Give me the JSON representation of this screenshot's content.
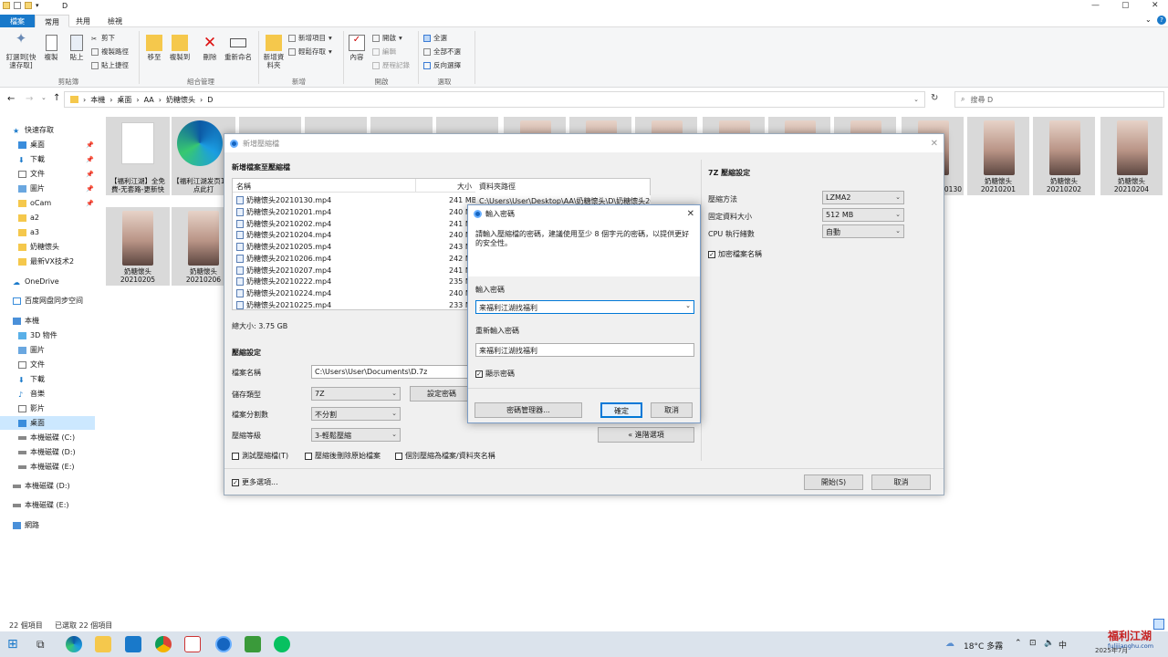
{
  "window": {
    "title": "D"
  },
  "tabs": [
    "檔案",
    "常用",
    "共用",
    "檢視"
  ],
  "ribbon": {
    "clipboard": {
      "pin_label": "釘選到[快速存取]",
      "copy_label": "複製",
      "paste_label": "貼上",
      "cut_label": "剪下",
      "copy_path_label": "複製路徑",
      "paste_shortcut_label": "貼上捷徑",
      "group": "剪貼簿"
    },
    "organize": {
      "move_label": "移至",
      "copy_to_label": "複製到",
      "delete_label": "刪除",
      "rename_label": "重新命名",
      "group": "組合管理"
    },
    "new": {
      "new_folder_label": "新增資料夾",
      "new_item_label": "新增項目",
      "easy_access_label": "輕鬆存取",
      "group": "新增"
    },
    "open": {
      "properties_label": "內容",
      "open_label": "開啟",
      "edit_label": "編輯",
      "history_label": "歷程記錄",
      "group": "開啟"
    },
    "select": {
      "select_all_label": "全選",
      "select_none_label": "全部不選",
      "invert_label": "反向選擇",
      "group": "選取"
    }
  },
  "address": {
    "parts": [
      "本機",
      "桌面",
      "AA",
      "奶糖懷头",
      "D"
    ],
    "search_placeholder": "搜尋 D"
  },
  "nav": {
    "quick_access": "快速存取",
    "quick_items": [
      "桌面",
      "下載",
      "文件",
      "圖片",
      "oCam",
      "a2",
      "a3",
      "奶糖懷头",
      "最新VX技术2"
    ],
    "onedrive": "OneDrive",
    "baidu": "百度网盘同步空间",
    "this_pc": "本機",
    "pc_items": [
      "3D 物件",
      "圖片",
      "文件",
      "下載",
      "音樂",
      "影片",
      "桌面",
      "本機磁碟 (C:)",
      "本機磁碟 (D:)",
      "本機磁碟 (E:)"
    ],
    "drives": [
      "本機磁碟 (D:)",
      "本機磁碟 (E:)"
    ],
    "network": "網路"
  },
  "tiles": {
    "t1": "【福利江湖】全免費-无套路-更新快",
    "t2": "【福利江湖发页1】-点此打",
    "r1": [
      "20210130",
      "奶糖懷头\n20210201",
      "奶糖懷头\n20210202",
      "奶糖懷头\n20210204"
    ],
    "r2": [
      "奶糖懷头\n20210205",
      "奶糖懷头\n20210206"
    ]
  },
  "status": {
    "count": "22 個項目",
    "selected": "已選取 22 個項目"
  },
  "taskbar": {
    "weather": "18°C 多霧",
    "time": "2025年7月"
  },
  "watermark": {
    "text": "福利江湖",
    "sub": "fulijianghu.com"
  },
  "archive": {
    "title": "新增壓縮檔",
    "heading": "新增檔案至壓縮檔",
    "col_name": "名稱",
    "col_size": "大小",
    "col_path": "資料夾路徑",
    "files": [
      {
        "name": "奶糖懷头20210130.mp4",
        "size": "241 MB",
        "path": "C:\\Users\\User\\Desktop\\AA\\奶糖懷头\\D\\奶糖懷头20210..."
      },
      {
        "name": "奶糖懷头20210201.mp4",
        "size": "240 MB",
        "path": ""
      },
      {
        "name": "奶糖懷头20210202.mp4",
        "size": "241 MB",
        "path": ""
      },
      {
        "name": "奶糖懷头20210204.mp4",
        "size": "240 MB",
        "path": ""
      },
      {
        "name": "奶糖懷头20210205.mp4",
        "size": "243 MB",
        "path": ""
      },
      {
        "name": "奶糖懷头20210206.mp4",
        "size": "242 MB",
        "path": ""
      },
      {
        "name": "奶糖懷头20210207.mp4",
        "size": "241 MB",
        "path": ""
      },
      {
        "name": "奶糖懷头20210222.mp4",
        "size": "235 MB",
        "path": ""
      },
      {
        "name": "奶糖懷头20210224.mp4",
        "size": "240 MB",
        "path": ""
      },
      {
        "name": "奶糖懷头20210225.mp4",
        "size": "233 MB",
        "path": ""
      }
    ],
    "total": "總大小: 3.75 GB",
    "settings_heading": "壓縮設定",
    "file_name_label": "檔案名稱",
    "file_name_value": "C:\\Users\\User\\Documents\\D.7z",
    "type_label": "儲存類型",
    "type_value": "7Z",
    "split_label": "檔案分割數",
    "split_value": "不分割",
    "level_label": "壓縮等級",
    "level_value": "3-輕鬆壓縮",
    "set_pwd_btn": "設定密碼",
    "advanced_btn": "« 進階選項",
    "test_cb": "測試壓縮檔(T)",
    "delete_cb": "壓縮後刪除原始檔案",
    "separate_cb": "個別壓縮為檔案/資料夾名稱",
    "more_cb": "更多選項...",
    "start_btn": "開始(S)",
    "cancel_btn": "取消",
    "z7_heading": "7Z 壓縮設定",
    "method_label": "壓縮方法",
    "method_value": "LZMA2",
    "dict_label": "固定資料大小",
    "dict_value": "512 MB",
    "cpu_label": "CPU 執行緒數",
    "cpu_value": "自動",
    "encrypt_cb": "加密檔案名稱"
  },
  "password": {
    "title": "輸入密碼",
    "desc": "請輸入壓縮檔的密碼，建議使用至少 8 個字元的密碼，以提供更好的安全性。",
    "enter_label": "輸入密碼",
    "enter_value": "来福利江湖找福利",
    "reenter_label": "重新輸入密碼",
    "reenter_value": "来福利江湖找福利",
    "show_cb": "顯示密碼",
    "manager_btn": "密碼管理器...",
    "ok_btn": "確定",
    "cancel_btn": "取消"
  }
}
